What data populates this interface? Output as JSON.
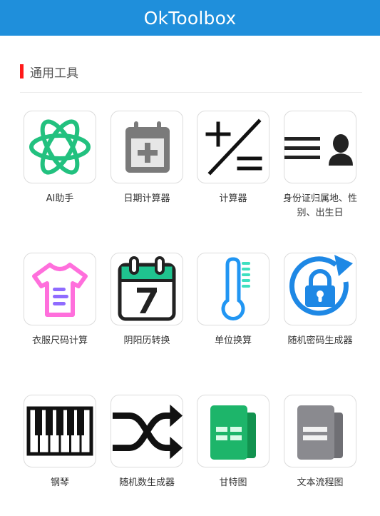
{
  "app": {
    "title": "OkToolbox"
  },
  "section": {
    "title": "通用工具"
  },
  "tools": [
    {
      "label": "AI助手",
      "icon": "atom-icon"
    },
    {
      "label": "日期计算器",
      "icon": "calendar-plus-icon"
    },
    {
      "label": "计算器",
      "icon": "calculator-symbols-icon"
    },
    {
      "label": "身份证归属地、性别、出生日",
      "icon": "id-card-person-icon"
    },
    {
      "label": "衣服尺码计算",
      "icon": "tshirt-icon"
    },
    {
      "label": "阴阳历转换",
      "icon": "calendar-7-icon"
    },
    {
      "label": "单位换算",
      "icon": "thermometer-icon"
    },
    {
      "label": "随机密码生成器",
      "icon": "lock-refresh-icon"
    },
    {
      "label": "钢琴",
      "icon": "piano-keys-icon"
    },
    {
      "label": "随机数生成器",
      "icon": "shuffle-icon"
    },
    {
      "label": "甘特图",
      "icon": "green-sheet-icon"
    },
    {
      "label": "文本流程图",
      "icon": "gray-document-icon"
    }
  ],
  "colors": {
    "header": "#1f8fdb",
    "section_marker": "#ff1a1a",
    "atom": "#22c17f",
    "calendar_gray": "#7a7a7a",
    "tshirt_pink": "#ff6fdc",
    "tshirt_purple": "#8f6bff",
    "calendar_green": "#1fc38f",
    "thermo_blue": "#2196f3",
    "thermo_teal": "#3ee0c0",
    "lock_blue": "#1e88e5",
    "sheet_green": "#1db56a",
    "doc_gray": "#8a8a8f"
  }
}
